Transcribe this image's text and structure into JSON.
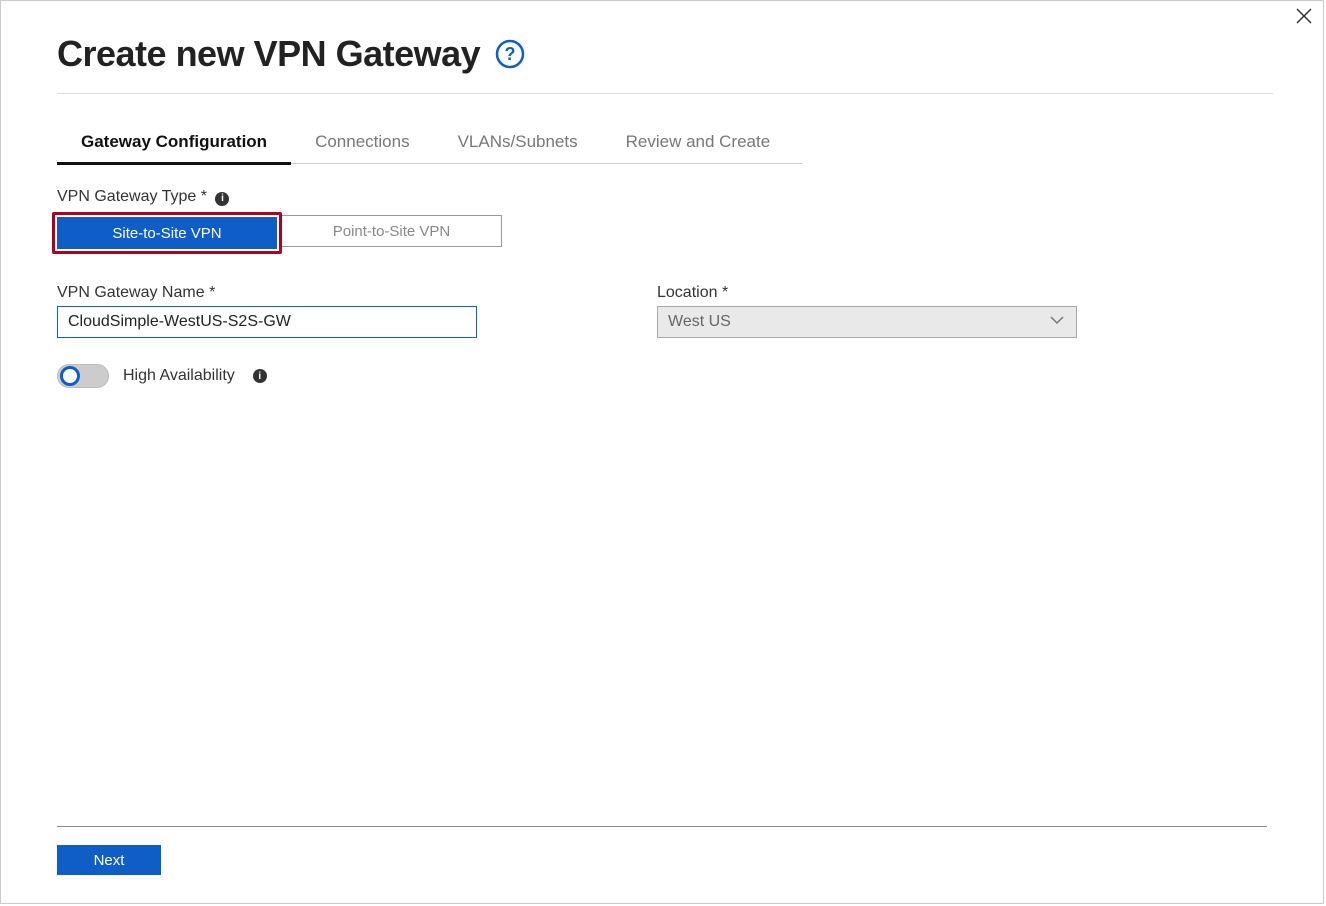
{
  "header": {
    "title": "Create new VPN Gateway"
  },
  "tabs": [
    {
      "label": "Gateway Configuration",
      "active": true
    },
    {
      "label": "Connections",
      "active": false
    },
    {
      "label": "VLANs/Subnets",
      "active": false
    },
    {
      "label": "Review and Create",
      "active": false
    }
  ],
  "gateway_type": {
    "label": "VPN Gateway Type",
    "required_mark": "*",
    "options": {
      "site_to_site": "Site-to-Site VPN",
      "point_to_site": "Point-to-Site VPN"
    },
    "selected": "site_to_site"
  },
  "gateway_name": {
    "label": "VPN Gateway Name",
    "required_mark": "*",
    "value": "CloudSimple-WestUS-S2S-GW"
  },
  "location": {
    "label": "Location",
    "required_mark": "*",
    "value": "West US"
  },
  "high_availability": {
    "label": "High Availability",
    "value": false
  },
  "footer": {
    "next": "Next"
  },
  "icons": {
    "help": "help-circle-icon",
    "info": "info-icon",
    "close": "close-icon",
    "chevron_down": "chevron-down-icon"
  }
}
